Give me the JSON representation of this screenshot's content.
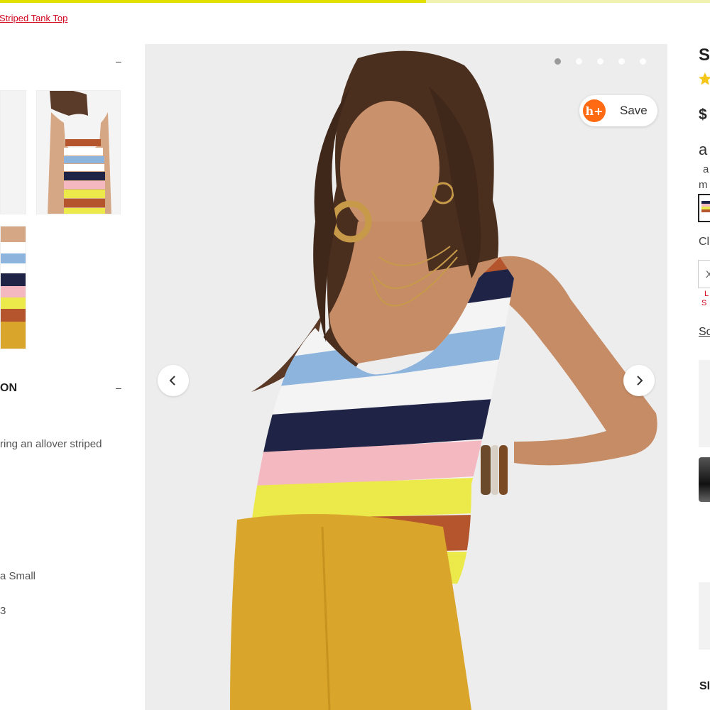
{
  "progress": {
    "fraction": 0.6
  },
  "breadcrumb": {
    "current": "Striped Tank Top"
  },
  "collapse": {
    "symbol": "–"
  },
  "section": {
    "title": "ON"
  },
  "description": {
    "line1": "ring an allover striped",
    "line2": "a Small",
    "line3": "3"
  },
  "gallery": {
    "dot_count": 5,
    "active_dot": 1
  },
  "save_button": {
    "logo": "h+",
    "label": "Save"
  },
  "right_panel": {
    "title_initial": "S",
    "price_initial": "$",
    "afterpay_initial": "a",
    "installment_line1": "a",
    "installment_line2": "m",
    "color_label_initial": "Cl",
    "size_initial": "X",
    "stock_line1": "L",
    "stock_line2": "S",
    "size_guide_initial": "So",
    "bottom_initial": "Sl"
  },
  "colors": {
    "accent_yellow": "#e3e000",
    "link_red": "#d0021b",
    "honey_orange": "#ff6a13",
    "star": "#f5c518"
  },
  "icons": {
    "prev": "chevron-left-icon",
    "next": "chevron-right-icon",
    "star": "star-icon"
  }
}
